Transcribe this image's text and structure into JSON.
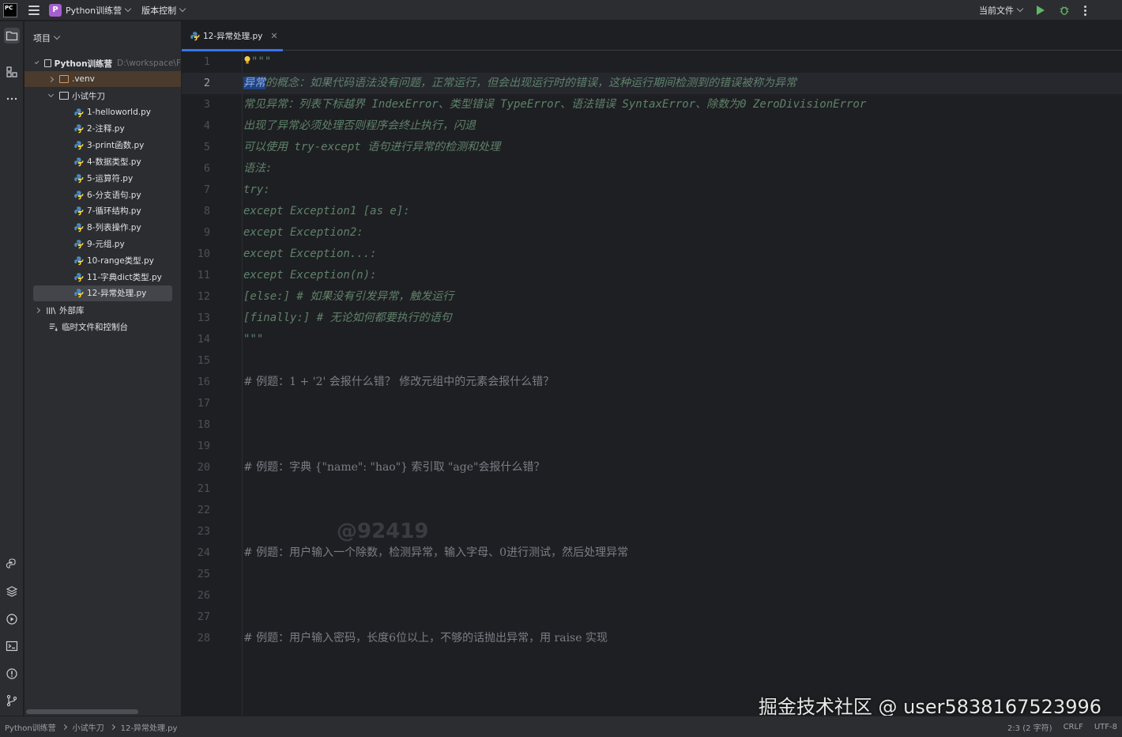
{
  "titlebar": {
    "app_logo": "PC",
    "project_badge": "P",
    "project_name": "Python训练营",
    "vcs_label": "版本控制",
    "run_config": "当前文件"
  },
  "project_panel": {
    "title": "项目",
    "root": {
      "name": "Python训练营",
      "path": "D:\\workspace\\F"
    },
    "venv": ".venv",
    "folder": "小试牛刀",
    "files": [
      "1-helloworld.py",
      "2-注释.py",
      "3-print函数.py",
      "4-数据类型.py",
      "5-运算符.py",
      "6-分支语句.py",
      "7-循环结构.py",
      "8-列表操作.py",
      "9-元组.py",
      "10-range类型.py",
      "11-字典dict类型.py",
      "12-异常处理.py"
    ],
    "external_libs": "外部库",
    "scratches": "临时文件和控制台"
  },
  "editor": {
    "tab_label": "12-异常处理.py",
    "current_line": 2,
    "lines": [
      "\"\"\"",
      "异常的概念：如果代码语法没有问题，正常运行，但会出现运行时的错误，这种运行期间检测到的错误被称为异常",
      "常见异常：列表下标越界 IndexError、类型错误 TypeError、语法错误 SyntaxError、除数为0 ZeroDivisionError",
      "出现了异常必须处理否则程序会终止执行，闪退",
      "可以使用 try-except 语句进行异常的检测和处理",
      "语法:",
      "try:",
      "except Exception1 [as e]:",
      "except Exception2:",
      "except Exception...:",
      "except Exception(n):",
      "[else:] # 如果没有引发异常，触发运行",
      "[finally:] # 无论如何都要执行的语句",
      "\"\"\"",
      "",
      "# 例题：1 + '2' 会报什么错？ 修改元组中的元素会报什么错？",
      "",
      "",
      "",
      "# 例题：字典 {\"name\": \"hao\"} 索引取 \"age\"会报什么错？",
      "",
      "",
      "",
      "# 例题：用户输入一个除数，检测异常，输入字母、0进行测试，然后处理异常",
      "",
      "",
      "",
      "# 例题：用户输入密码，长度6位以上，不够的话抛出异常，用 raise 实现"
    ],
    "selected_text": "异常"
  },
  "overlay": {
    "watermark_user": "@92419",
    "watermark_site": "掘金技术社区 @ user5838167523996"
  },
  "statusbar": {
    "crumbs": [
      "Python训练营",
      "小试牛刀",
      "12-异常处理.py"
    ],
    "position": "2:3 (2 字符)",
    "line_sep": "CRLF",
    "encoding": "UTF-8"
  }
}
